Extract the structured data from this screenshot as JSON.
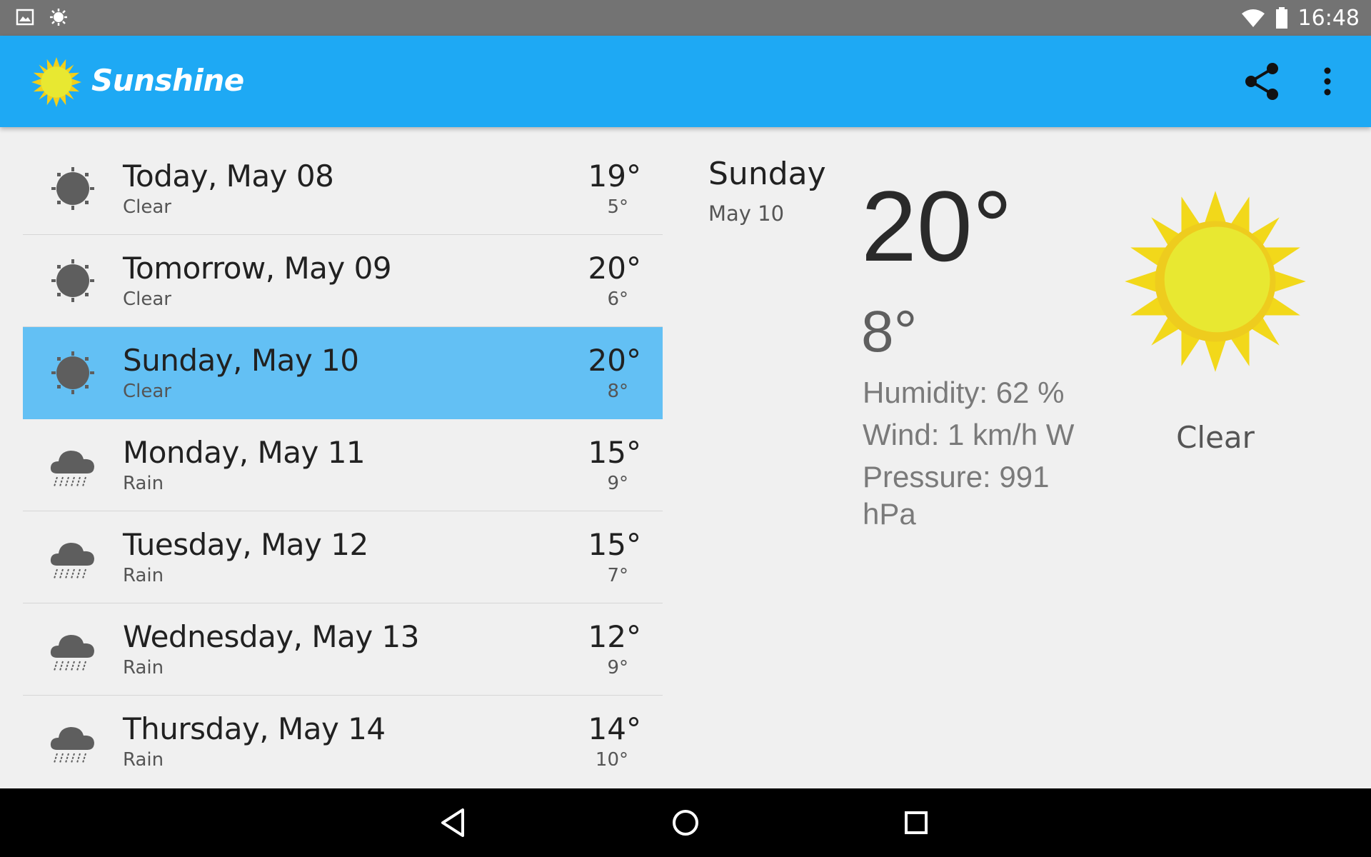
{
  "status_bar": {
    "time": "16:48",
    "icons": [
      "image-icon",
      "brightness-icon",
      "wifi-icon",
      "battery-icon"
    ]
  },
  "app_bar": {
    "title": "Sunshine",
    "logo": "sun-icon",
    "actions": [
      "share-icon",
      "more-vert-icon"
    ]
  },
  "forecast": [
    {
      "date": "Today, May 08",
      "desc": "Clear",
      "high": "19°",
      "low": "5°",
      "icon": "clear-icon"
    },
    {
      "date": "Tomorrow, May 09",
      "desc": "Clear",
      "high": "20°",
      "low": "6°",
      "icon": "clear-icon"
    },
    {
      "date": "Sunday, May 10",
      "desc": "Clear",
      "high": "20°",
      "low": "8°",
      "icon": "clear-icon",
      "selected": true
    },
    {
      "date": "Monday, May 11",
      "desc": "Rain",
      "high": "15°",
      "low": "9°",
      "icon": "rain-icon"
    },
    {
      "date": "Tuesday, May 12",
      "desc": "Rain",
      "high": "15°",
      "low": "7°",
      "icon": "rain-icon"
    },
    {
      "date": "Wednesday, May 13",
      "desc": "Rain",
      "high": "12°",
      "low": "9°",
      "icon": "rain-icon"
    },
    {
      "date": "Thursday, May 14",
      "desc": "Rain",
      "high": "14°",
      "low": "10°",
      "icon": "rain-icon"
    }
  ],
  "detail": {
    "day": "Sunday",
    "date": "May 10",
    "high": "20°",
    "low": "8°",
    "humidity": "Humidity: 62 %",
    "wind": "Wind: 1 km/h W",
    "pressure": "Pressure: 991 hPa",
    "condition": "Clear",
    "art": "sun-art-icon"
  },
  "colors": {
    "app_bar": "#1ea9f4",
    "selected_row": "#63c0f4",
    "status_bar": "#737373",
    "sun_yellow": "#e8e831",
    "sun_rays": "#f2cf1a"
  },
  "nav_bar": [
    "back-icon",
    "home-icon",
    "recents-icon"
  ]
}
